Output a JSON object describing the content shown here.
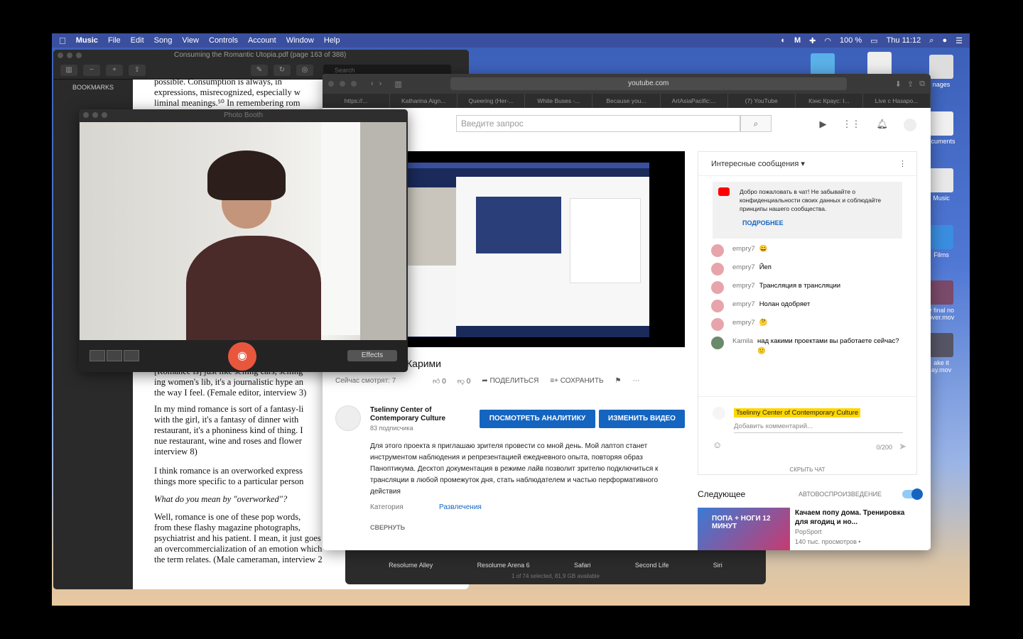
{
  "menubar": {
    "app_name": "Music",
    "items": [
      "File",
      "Edit",
      "Song",
      "View",
      "Controls",
      "Account",
      "Window",
      "Help"
    ],
    "battery": "100 %",
    "clock": "Thu 11:12"
  },
  "desktop": {
    "items": [
      "nages",
      "ocuments",
      "Music",
      "Films",
      "y final no\nover.mov",
      "ake it\nay.mov"
    ]
  },
  "pdf": {
    "title": "Consuming the Romantic Utopia.pdf (page 163 of 388)",
    "search_placeholder": "Search",
    "sidebar_label": "BOOKMARKS",
    "para_top": [
      "possible. Consumption is always, in",
      "expressions, misrecognized, especially w",
      "liminal meanings.⁵⁰ In remembering rom"
    ],
    "para_mid": [
      "[Romance is] just like selling cars, selling",
      "ing women's lib, it's a journalistic hype an",
      "the way I feel. (Female editor, interview 3)"
    ],
    "para_2": [
      "In my mind romance is sort of a fantasy-li",
      "with the girl, it's a fantasy of dinner with",
      "restaurant, it's a phoniness kind of thing. I",
      "nue restaurant, wine and roses and flower",
      "interview 8)"
    ],
    "para_3": [
      "I think romance is an overworked express",
      "things more specific to a particular person"
    ],
    "question": "What do you mean by \"overworked\"?",
    "para_4": [
      "Well, romance is one of these pop words,",
      "from these flashy magazine photographs,",
      "psychiatrist and his patient. I mean, it just goes",
      "an overcommercialization of an emotion which",
      "the term relates. (Male cameraman, interview 2"
    ]
  },
  "photobooth": {
    "title": "Photo Booth",
    "effects_label": "Effects"
  },
  "launcher": {
    "apps": [
      "Resolume Alley",
      "Resolume Arena 6",
      "Safari",
      "Second Life",
      "Siri"
    ],
    "status": "1 of 74 selected, 81,9 GB available"
  },
  "browser": {
    "url": "youtube.com",
    "tabs": [
      "https://...",
      "Katharina Aign...",
      "Queering (Her-...",
      "White Buses -...",
      "Because you...",
      "ArtAsiaPacific:...",
      "(7) YouTube",
      "Кэнс Краус: I...",
      "Live с Назаро..."
    ]
  },
  "youtube": {
    "search_placeholder": "Введите запрос",
    "video_title": "Карими",
    "watching_now": "Сейчас смотрят: 7",
    "likes": "0",
    "dislikes": "0",
    "share_label": "ПОДЕЛИТЬСЯ",
    "save_label": "СОХРАНИТЬ",
    "channel_name": "Tselinny Center of Contemporary Culture",
    "subscribers": "83 подписчика",
    "analytics_button": "ПОСМОТРЕТЬ АНАЛИТИКУ",
    "edit_button": "ИЗМЕНИТЬ ВИДЕО",
    "description": "Для этого проекта я приглашаю зрителя провести со мной день. Мой лаптоп станет инструментом наблюдения и репрезентацией ежедневного опыта, повторяя образ Паноптикума. Десктоп документация в режиме лайв позволит зрителю подключиться к трансляции в любой промежуток дня, стать наблюдателем и частью перформативного действия",
    "category_label": "Категория",
    "category_value": "Развлечения",
    "collapse_label": "СВЕРНУТЬ",
    "chat": {
      "header": "Интересные сообщения",
      "welcome_text": "Добро пожаловать в чат! Не забывайте о конфиденциальности своих данных и соблюдайте принципы нашего сообщества.",
      "more_link": "ПОДРОБНЕЕ",
      "messages": [
        {
          "user": "empry7",
          "text": "😀"
        },
        {
          "user": "empry7",
          "text": "Йеп"
        },
        {
          "user": "empry7",
          "text": "Трансляция в трансляции"
        },
        {
          "user": "empry7",
          "text": "Нолан одобряет"
        },
        {
          "user": "empry7",
          "text": "🤔"
        },
        {
          "user": "Kamila",
          "text": "над какими проектами вы работаете сейчас? 🙂"
        }
      ],
      "author_name": "Tselinny Center of Contemporary Culture",
      "comment_placeholder": "Добавить комментарий...",
      "char_count": "0/200",
      "hide_chat": "СКРЫТЬ ЧАТ"
    },
    "next_header": "Следующее",
    "autoplay_label": "АВТОВОСПРОИЗВЕДЕНИЕ",
    "next_thumb_text": "ПОПА + НОГИ 12 МИНУТ",
    "next_video": {
      "title": "Качаем попу дома. Тренировка для ягодиц и но...",
      "channel": "PopSport",
      "views": "140 тыс. просмотров •"
    }
  }
}
